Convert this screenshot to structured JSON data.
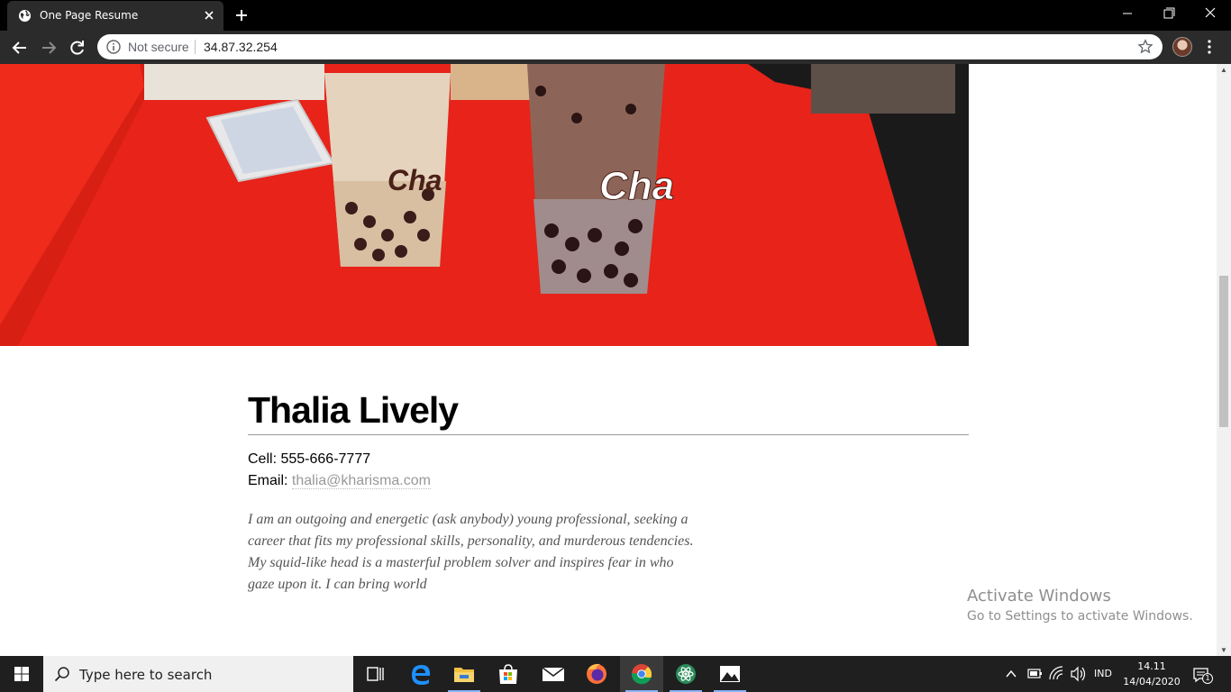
{
  "browser": {
    "tab_title": "One Page Resume",
    "security_label": "Not secure",
    "url": "34.87.32.254"
  },
  "resume": {
    "name": "Thalia Lively",
    "cell_label": "Cell:",
    "cell_value": "555-666-7777",
    "email_label": "Email:",
    "email_value": "thalia@kharisma.com",
    "bio": "I am an outgoing and energetic (ask anybody) young professional, seeking a career that fits my professional skills, personality, and murderous tendencies. My squid-like head is a masterful problem solver and inspires fear in who gaze upon it. I can bring world"
  },
  "hero_image": {
    "cup_text": "Cha",
    "accent": "#e7231a"
  },
  "watermark": {
    "title": "Activate Windows",
    "subtitle": "Go to Settings to activate Windows."
  },
  "taskbar": {
    "search_placeholder": "Type here to search",
    "language": "IND",
    "time": "14.11",
    "date": "14/04/2020",
    "notification_count": "1"
  }
}
